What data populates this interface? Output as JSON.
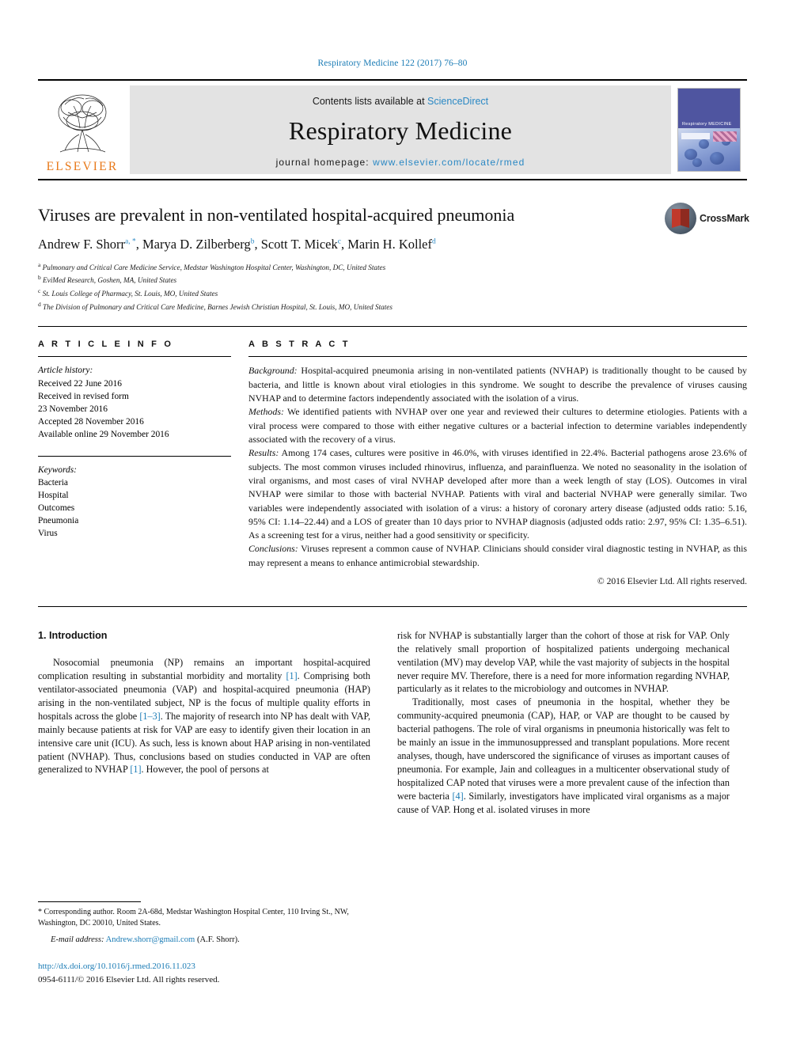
{
  "running_head": "Respiratory Medicine 122 (2017) 76–80",
  "masthead": {
    "publisher": "ELSEVIER",
    "contents_prefix": "Contents lists available at ",
    "contents_link": "ScienceDirect",
    "journal_title": "Respiratory Medicine",
    "homepage_label": "journal homepage: ",
    "homepage_url": "www.elsevier.com/locate/rmed",
    "cover_title": "Respiratory MEDICINE",
    "cover_url": "www.elsevier.com"
  },
  "article": {
    "title": "Viruses are prevalent in non-ventilated hospital-acquired pneumonia",
    "crossmark_label": "CrossMark",
    "authors": [
      {
        "name": "Andrew F. Shorr",
        "marks": "a, *",
        "sep": ", "
      },
      {
        "name": "Marya D. Zilberberg",
        "marks": "b",
        "sep": ", "
      },
      {
        "name": "Scott T. Micek",
        "marks": "c",
        "sep": ", "
      },
      {
        "name": "Marin H. Kollef",
        "marks": "d",
        "sep": ""
      }
    ],
    "affiliations": [
      {
        "mark": "a",
        "text": "Pulmonary and Critical Care Medicine Service, Medstar Washington Hospital Center, Washington, DC, United States"
      },
      {
        "mark": "b",
        "text": "EviMed Research, Goshen, MA, United States"
      },
      {
        "mark": "c",
        "text": "St. Louis College of Pharmacy, St. Louis, MO, United States"
      },
      {
        "mark": "d",
        "text": "The Division of Pulmonary and Critical Care Medicine, Barnes Jewish Christian Hospital, St. Louis, MO, United States"
      }
    ]
  },
  "article_info": {
    "heading": "A R T I C L E   I N F O",
    "history_label": "Article history:",
    "history": [
      "Received 22 June 2016",
      "Received in revised form",
      "23 November 2016",
      "Accepted 28 November 2016",
      "Available online 29 November 2016"
    ],
    "keywords_label": "Keywords:",
    "keywords": [
      "Bacteria",
      "Hospital",
      "Outcomes",
      "Pneumonia",
      "Virus"
    ]
  },
  "abstract": {
    "heading": "A B S T R A C T",
    "sections": [
      {
        "label": "Background:",
        "text": " Hospital-acquired pneumonia arising in non-ventilated patients (NVHAP) is traditionally thought to be caused by bacteria, and little is known about viral etiologies in this syndrome. We sought to describe the prevalence of viruses causing NVHAP and to determine factors independently associated with the isolation of a virus."
      },
      {
        "label": "Methods:",
        "text": " We identified patients with NVHAP over one year and reviewed their cultures to determine etiologies. Patients with a viral process were compared to those with either negative cultures or a bacterial infection to determine variables independently associated with the recovery of a virus."
      },
      {
        "label": "Results:",
        "text": " Among 174 cases, cultures were positive in 46.0%, with viruses identified in 22.4%. Bacterial pathogens arose 23.6% of subjects. The most common viruses included rhinovirus, influenza, and parainfluenza. We noted no seasonality in the isolation of viral organisms, and most cases of viral NVHAP developed after more than a week length of stay (LOS). Outcomes in viral NVHAP were similar to those with bacterial NVHAP. Patients with viral and bacterial NVHAP were generally similar. Two variables were independently associated with isolation of a virus: a history of coronary artery disease (adjusted odds ratio: 5.16, 95% CI: 1.14–22.44) and a LOS of greater than 10 days prior to NVHAP diagnosis (adjusted odds ratio: 2.97, 95% CI: 1.35–6.51). As a screening test for a virus, neither had a good sensitivity or specificity."
      },
      {
        "label": "Conclusions:",
        "text": " Viruses represent a common cause of NVHAP. Clinicians should consider viral diagnostic testing in NVHAP, as this may represent a means to enhance antimicrobial stewardship."
      }
    ],
    "copyright": "© 2016 Elsevier Ltd. All rights reserved."
  },
  "introduction": {
    "section_title": "1. Introduction",
    "left_paragraphs": [
      "Nosocomial pneumonia (NP) remains an important hospital-acquired complication resulting in substantial morbidity and mortality [1]. Comprising both ventilator-associated pneumonia (VAP) and hospital-acquired pneumonia (HAP) arising in the non-ventilated subject, NP is the focus of multiple quality efforts in hospitals across the globe [1–3]. The majority of research into NP has dealt with VAP, mainly because patients at risk for VAP are easy to identify given their location in an intensive care unit (ICU). As such, less is known about HAP arising in non-ventilated patient (NVHAP). Thus, conclusions based on studies conducted in VAP are often generalized to NVHAP [1]. However, the pool of persons at"
    ],
    "right_paragraphs": [
      "risk for NVHAP is substantially larger than the cohort of those at risk for VAP. Only the relatively small proportion of hospitalized patients undergoing mechanical ventilation (MV) may develop VAP, while the vast majority of subjects in the hospital never require MV. Therefore, there is a need for more information regarding NVHAP, particularly as it relates to the microbiology and outcomes in NVHAP.",
      "Traditionally, most cases of pneumonia in the hospital, whether they be community-acquired pneumonia (CAP), HAP, or VAP are thought to be caused by bacterial pathogens. The role of viral organisms in pneumonia historically was felt to be mainly an issue in the immunosuppressed and transplant populations. More recent analyses, though, have underscored the significance of viruses as important causes of pneumonia. For example, Jain and colleagues in a multicenter observational study of hospitalized CAP noted that viruses were a more prevalent cause of the infection than were bacteria [4]. Similarly, investigators have implicated viral organisms as a major cause of VAP. Hong et al. isolated viruses in more"
    ]
  },
  "footnotes": {
    "corresponding": "* Corresponding author. Room 2A-68d, Medstar Washington Hospital Center, 110 Irving St., NW, Washington, DC 20010, United States.",
    "email_label": "E-mail address:",
    "email": "Andrew.shorr@gmail.com",
    "email_suffix": " (A.F. Shorr).",
    "doi": "http://dx.doi.org/10.1016/j.rmed.2016.11.023",
    "issn_line": "0954-6111/© 2016 Elsevier Ltd. All rights reserved."
  },
  "colors": {
    "link": "#1a7bb5",
    "elsevier_orange": "#e8791a",
    "banner_bg": "#e3e3e3"
  }
}
